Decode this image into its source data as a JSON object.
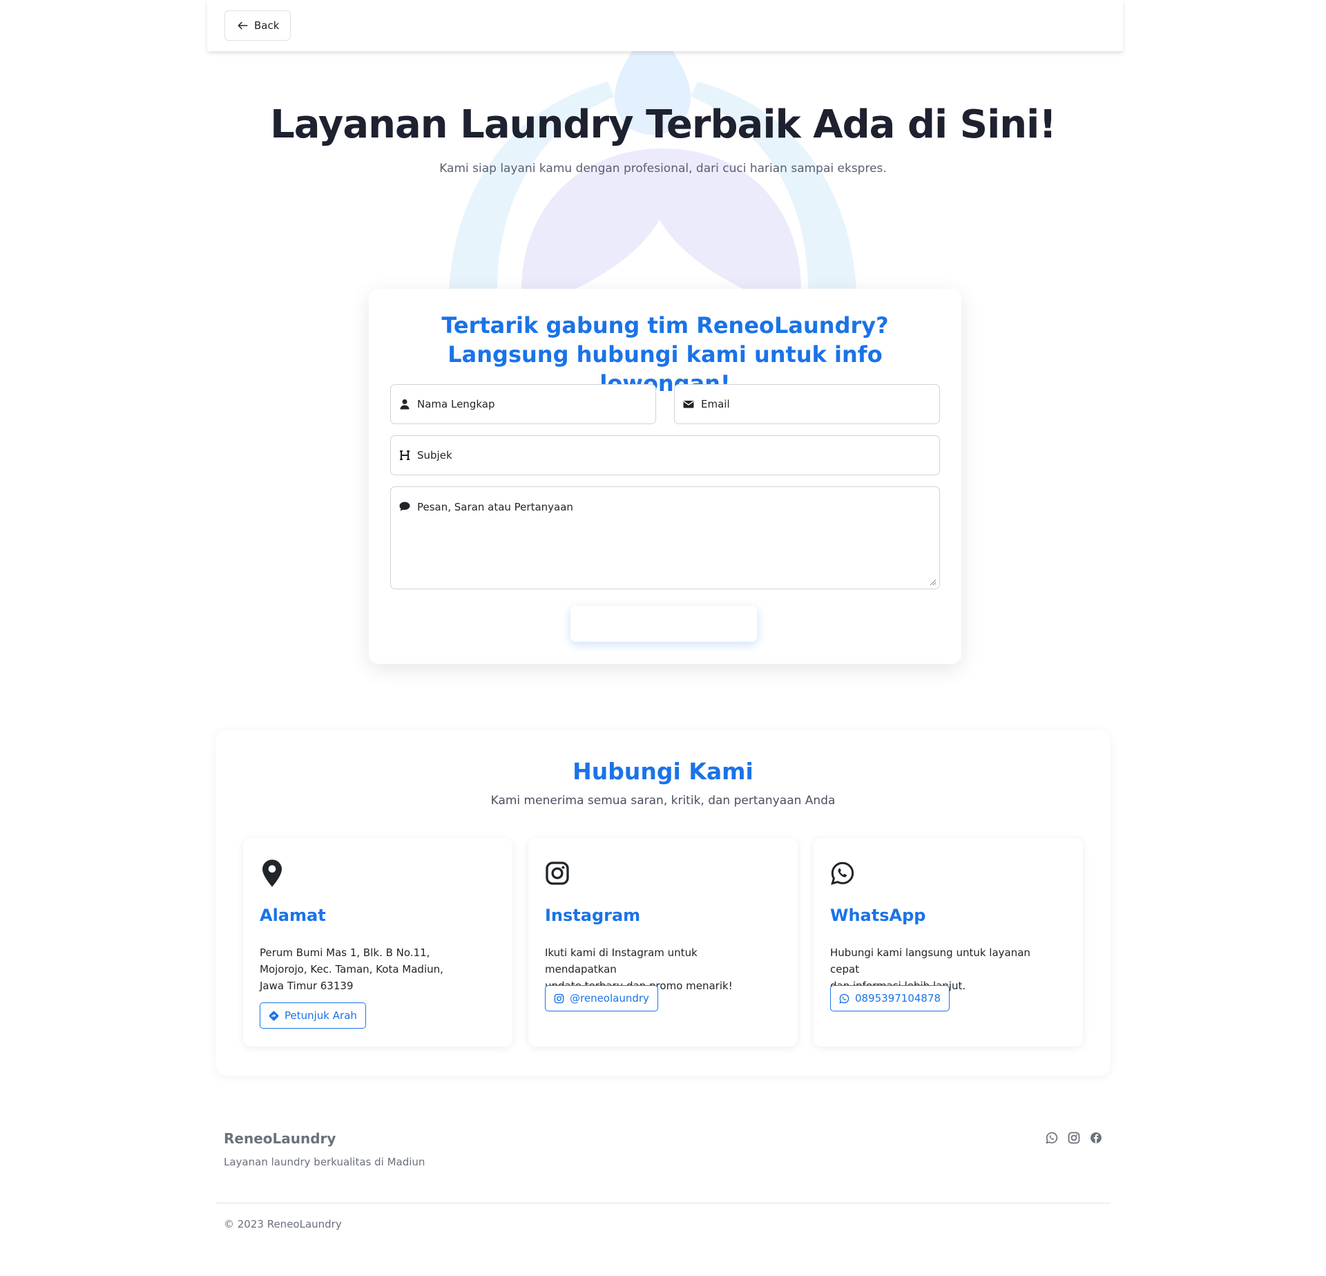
{
  "topbar": {
    "back_label": "Back"
  },
  "hero": {
    "title": "Layanan Laundry Terbaik Ada di Sini!",
    "subtitle": "Kami siap layani kamu dengan profesional, dari cuci harian sampai ekspres."
  },
  "form": {
    "title": "Tertarik gabung tim ReneoLaundry? Langsung hubungi kami untuk info lowongan!",
    "name_placeholder": "Nama Lengkap",
    "email_placeholder": "Email",
    "subject_placeholder": "Subjek",
    "message_placeholder": "Pesan, Saran atau Pertanyaan",
    "submit_label": ""
  },
  "contact": {
    "title": "Hubungi Kami",
    "subtitle": "Kami menerima semua saran, kritik, dan pertanyaan Anda",
    "cards": [
      {
        "icon": "map-pin-icon",
        "title": "Alamat",
        "lines": [
          "Perum Bumi Mas 1, Blk. B No.11,",
          "Mojorojo, Kec. Taman, Kota Madiun,",
          "Jawa Timur 63139"
        ],
        "button": "Petunjuk Arah",
        "button_icon": "directions-icon"
      },
      {
        "icon": "instagram-icon",
        "title": "Instagram",
        "lines": [
          "Ikuti kami di Instagram untuk mendapatkan",
          "update terbaru dan promo menarik!"
        ],
        "button": "@reneolaundry",
        "button_icon": "instagram-icon"
      },
      {
        "icon": "whatsapp-icon",
        "title": "WhatsApp",
        "lines": [
          "Hubungi kami langsung untuk layanan cepat",
          "dan informasi lebih lanjut."
        ],
        "button": "0895397104878",
        "button_icon": "whatsapp-icon"
      }
    ]
  },
  "footer": {
    "brand": "ReneoLaundry",
    "tagline": "Layanan laundry berkualitas di Madiun",
    "copyright": "© 2023 ReneoLaundry",
    "social": [
      "whatsapp-icon",
      "instagram-icon",
      "facebook-icon"
    ]
  },
  "colors": {
    "accent": "#1a73e8",
    "heading": "#1d2130",
    "muted": "#6b717d"
  }
}
